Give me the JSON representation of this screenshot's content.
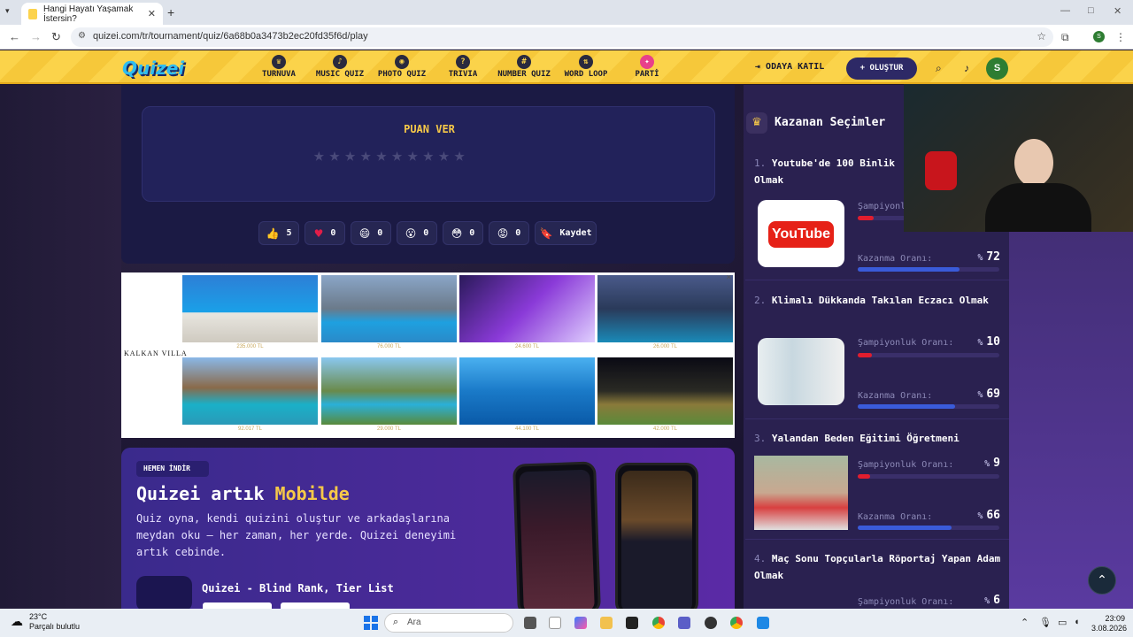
{
  "browser": {
    "tab_title": "Hangi Hayatı Yaşamak İstersin?",
    "tab_close": "✕",
    "new_tab": "+",
    "url": "quizei.com/tr/tournament/quiz/6a68b0a3473b2ec20fd35f6d/play",
    "profile_initial": "S"
  },
  "header": {
    "logo": "Quizei",
    "nav": [
      {
        "label": "TURNUVA",
        "icon": "♛"
      },
      {
        "label": "MUSIC QUIZ",
        "icon": "♪"
      },
      {
        "label": "PHOTO QUIZ",
        "icon": "◉"
      },
      {
        "label": "TRIVIA",
        "icon": "?"
      },
      {
        "label": "NUMBER QUIZ",
        "icon": "#"
      },
      {
        "label": "WORD LOOP",
        "icon": "⇅"
      },
      {
        "label": "PARTİ",
        "icon": "✦"
      }
    ],
    "join_label": "ODAYA KATIL",
    "create_label": "+ OLUŞTUR",
    "user_initial": "S"
  },
  "rating": {
    "title": "PUAN VER",
    "stars": "★★★★★★★★★★"
  },
  "reactions": [
    {
      "icon": "👍",
      "count": "5"
    },
    {
      "icon": "♥",
      "count": "0"
    },
    {
      "icon": "😄",
      "count": "0"
    },
    {
      "icon": "😮",
      "count": "0"
    },
    {
      "icon": "😳",
      "count": "0"
    },
    {
      "icon": "😡",
      "count": "0"
    }
  ],
  "save_label": "Kaydet",
  "ad": {
    "brand": "KALKAN VILLA",
    "prices": [
      "235.000 TL",
      "76.000 TL",
      "24.600 TL",
      "26.000 TL",
      "92.017 TL",
      "29.000 TL",
      "44.100 TL",
      "42.000 TL"
    ],
    "close": "✕"
  },
  "promo": {
    "badge": "HEMEN İNDİR",
    "title_prefix": "Quizei artık ",
    "title_highlight": "Mobilde",
    "text": "Quiz oyna, kendi quizini oluştur ve arkadaşlarına meydan oku — her zaman, her yerde. Quizei deneyimi artık cebinde.",
    "app_name": "Quizei - Blind Rank, Tier List"
  },
  "winners": {
    "title": "Kazanan Seçimler",
    "champion_label": "Şampiyonluk Oranı:",
    "win_label": "Kazanma Oranı:",
    "percent_sign": "%",
    "items": [
      {
        "num": "1.",
        "title": "Youtube'de 100 Binlik Olmak",
        "champion": "",
        "win": "72",
        "champion_pct": 0.11,
        "win_pct": 0.72
      },
      {
        "num": "2.",
        "title": "Klimalı Dükkanda Takılan Eczacı Olmak",
        "champion": "10",
        "win": "69",
        "champion_pct": 0.1,
        "win_pct": 0.69
      },
      {
        "num": "3.",
        "title": "Yalandan Beden Eğitimi Öğretmeni",
        "champion": "9",
        "win": "66",
        "champion_pct": 0.09,
        "win_pct": 0.66
      },
      {
        "num": "4.",
        "title": "Maç Sonu Topçularla Röportaj Yapan Adam Olmak",
        "champion": "6",
        "win": ""
      }
    ]
  },
  "taskbar": {
    "temp": "23°C",
    "weather": "Parçalı bulutlu",
    "search": "Ara",
    "time": "23:09",
    "date": "3.08.2026"
  },
  "colors": {
    "accent": "#f7c948",
    "champion_bar": "#e11d2e",
    "win_bar": "#3a5bd9"
  }
}
